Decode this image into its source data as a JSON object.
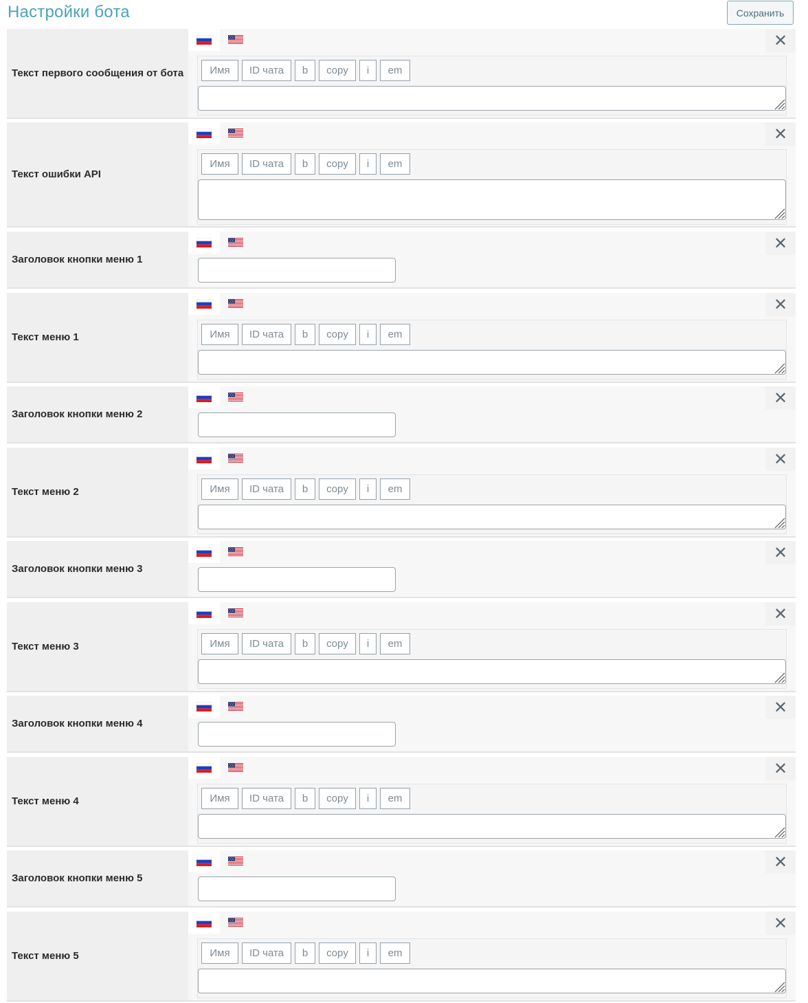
{
  "page": {
    "title": "Настройки бота",
    "save_label": "Сохранить"
  },
  "toolbar": {
    "buttons": [
      "Имя",
      "ID чата",
      "b",
      "copy",
      "i",
      "em"
    ]
  },
  "languages": [
    "ru",
    "en"
  ],
  "close_glyph": "✕",
  "colors": {
    "title": "#4aa3b8",
    "label_bg": "#efefef",
    "content_bg": "#f7f7f7"
  },
  "fields": [
    {
      "label": "Текст первого сообщения от бота",
      "type": "textarea",
      "value": ""
    },
    {
      "label": "Текст ошибки API",
      "type": "textarea",
      "value": ""
    },
    {
      "label": "Заголовок кнопки меню 1",
      "type": "input",
      "value": ""
    },
    {
      "label": "Текст меню 1",
      "type": "textarea",
      "value": ""
    },
    {
      "label": "Заголовок кнопки меню 2",
      "type": "input",
      "value": ""
    },
    {
      "label": "Текст меню 2",
      "type": "textarea",
      "value": ""
    },
    {
      "label": "Заголовок кнопки меню 3",
      "type": "input",
      "value": ""
    },
    {
      "label": "Текст меню 3",
      "type": "textarea",
      "value": ""
    },
    {
      "label": "Заголовок кнопки меню 4",
      "type": "input",
      "value": ""
    },
    {
      "label": "Текст меню 4",
      "type": "textarea",
      "value": ""
    },
    {
      "label": "Заголовок кнопки меню 5",
      "type": "input",
      "value": ""
    },
    {
      "label": "Текст меню 5",
      "type": "textarea",
      "value": ""
    }
  ]
}
